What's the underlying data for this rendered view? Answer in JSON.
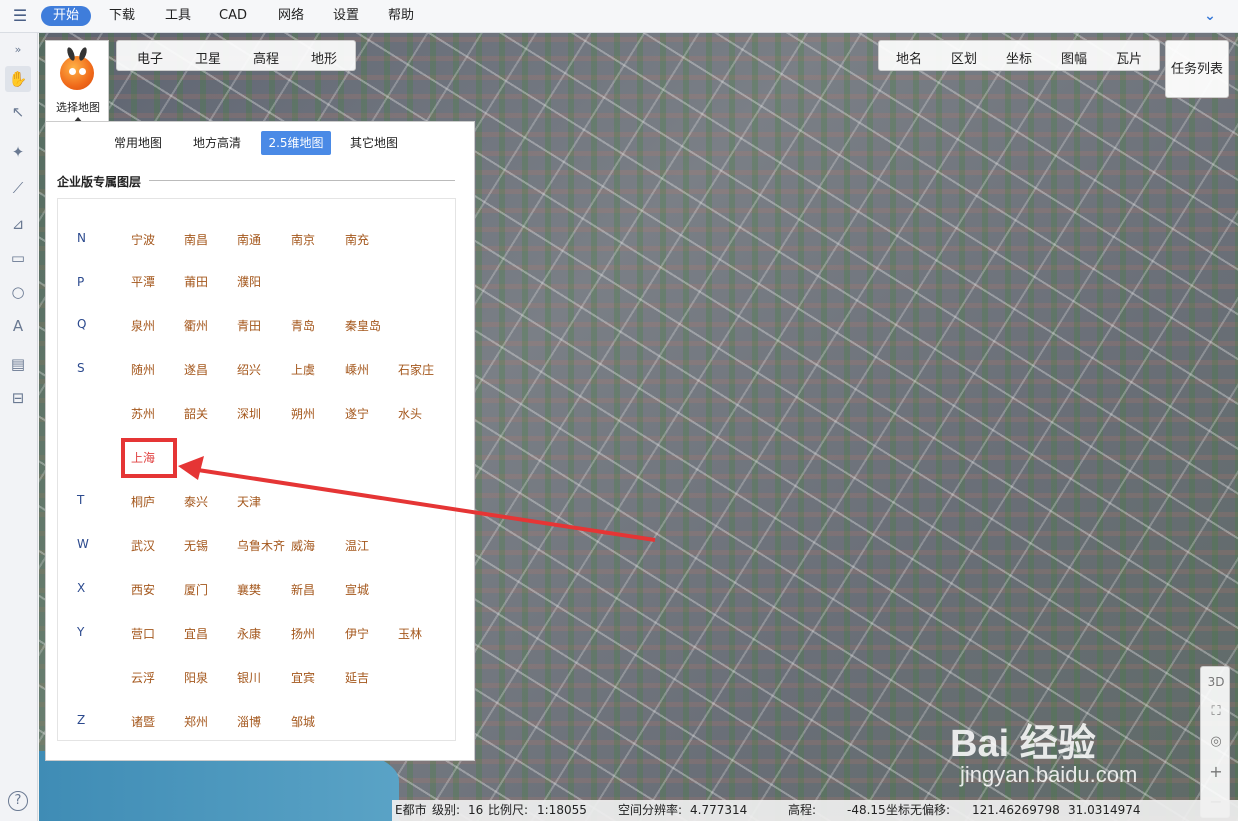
{
  "menu": {
    "items": [
      "开始",
      "下载",
      "工具",
      "CAD",
      "网络",
      "设置",
      "帮助"
    ]
  },
  "logo": {
    "label": "选择地图"
  },
  "map_types": [
    "电子",
    "卫星",
    "高程",
    "地形"
  ],
  "right_tabs": [
    "地名",
    "区划",
    "坐标",
    "图幅",
    "瓦片"
  ],
  "task_list": "任务列表",
  "panel": {
    "tabs": [
      "常用地图",
      "地方高清",
      "2.5维地图",
      "其它地图"
    ],
    "active_tab": "2.5维地图",
    "section_title": "企业版专属图层",
    "groups": [
      {
        "letter": "N",
        "cities": [
          "宁波",
          "南昌",
          "南通",
          "南京",
          "南充"
        ]
      },
      {
        "letter": "",
        "cities": [
          "平潭",
          "莆田",
          "濮阳"
        ]
      },
      {
        "letter": "P",
        "cities": []
      },
      {
        "letter": "Q",
        "cities": [
          "泉州",
          "衢州",
          "青田",
          "青岛",
          "秦皇岛"
        ]
      },
      {
        "letter": "S",
        "cities": [
          "随州",
          "遂昌",
          "绍兴",
          "上虞",
          "嵊州",
          "石家庄"
        ]
      },
      {
        "letter": "",
        "cities": [
          "苏州",
          "韶关",
          "深圳",
          "朔州",
          "遂宁",
          "水头"
        ]
      },
      {
        "letter": "",
        "cities": [
          "上海"
        ]
      },
      {
        "letter": "T",
        "cities": [
          "桐庐",
          "泰兴",
          "天津"
        ]
      },
      {
        "letter": "W",
        "cities": [
          "武汉",
          "无锡",
          "乌鲁木齐",
          "威海",
          "温江"
        ]
      },
      {
        "letter": "X",
        "cities": [
          "西安",
          "厦门",
          "襄樊",
          "新昌",
          "宣城"
        ]
      },
      {
        "letter": "Y",
        "cities": [
          "营口",
          "宜昌",
          "永康",
          "扬州",
          "伊宁",
          "玉林"
        ]
      },
      {
        "letter": "",
        "cities": [
          "云浮",
          "阳泉",
          "银川",
          "宜宾",
          "延吉"
        ]
      },
      {
        "letter": "Z",
        "cities": [
          "诸暨",
          "郑州",
          "淄博",
          "邹城"
        ]
      }
    ],
    "highlighted_city": "上海"
  },
  "right_controls": [
    "3D",
    "fullscreen-icon",
    "locate-icon",
    "+",
    "−"
  ],
  "status": {
    "source": "E都市",
    "level_label": "级别:",
    "level": "16",
    "scale_label": "比例尺:",
    "scale": "1:18055",
    "resolution_label": "空间分辨率:",
    "resolution": "4.777314",
    "elevation_label": "高程:",
    "elevation": "-48.15",
    "coord_label": "坐标无偏移:",
    "lon": "121.46269798",
    "lat": "31.0314974"
  },
  "watermark": {
    "brand": "Bai 经验",
    "url": "jingyan.baidu.com"
  },
  "colors": {
    "accent": "#3f7ddb",
    "city_text": "#a4571c",
    "letter_text": "#2c4a8e",
    "highlight": "#e53535"
  }
}
